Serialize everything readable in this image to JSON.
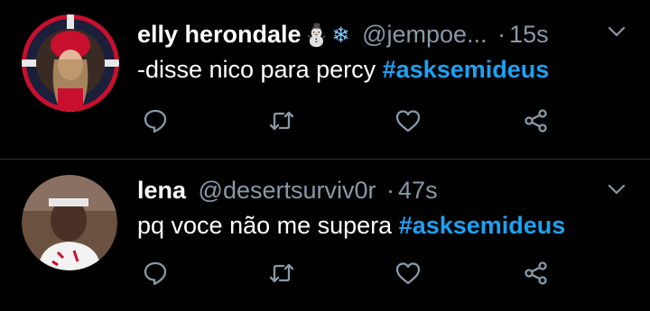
{
  "colors": {
    "background": "#000000",
    "text": "#ffffff",
    "muted": "#8899a6",
    "hashtag": "#1da1f2",
    "divider": "#2f3336"
  },
  "tweets": [
    {
      "name": "elly herondale",
      "name_emoji_1": "⛄",
      "name_emoji_2": "❄",
      "handle": "@jempoe...",
      "dot": "·",
      "time": "15s",
      "text": "-disse nico para percy ",
      "hashtag": "#asksemideus",
      "icons": [
        "reply-icon",
        "retweet-icon",
        "like-icon",
        "share-icon",
        "chevron-down-icon"
      ]
    },
    {
      "name": "lena",
      "handle": "@desertsurviv0r",
      "dot": "·",
      "time": "47s",
      "text": "pq voce não me supera ",
      "hashtag": "#asksemideus",
      "icons": [
        "reply-icon",
        "retweet-icon",
        "like-icon",
        "share-icon",
        "chevron-down-icon"
      ]
    }
  ]
}
